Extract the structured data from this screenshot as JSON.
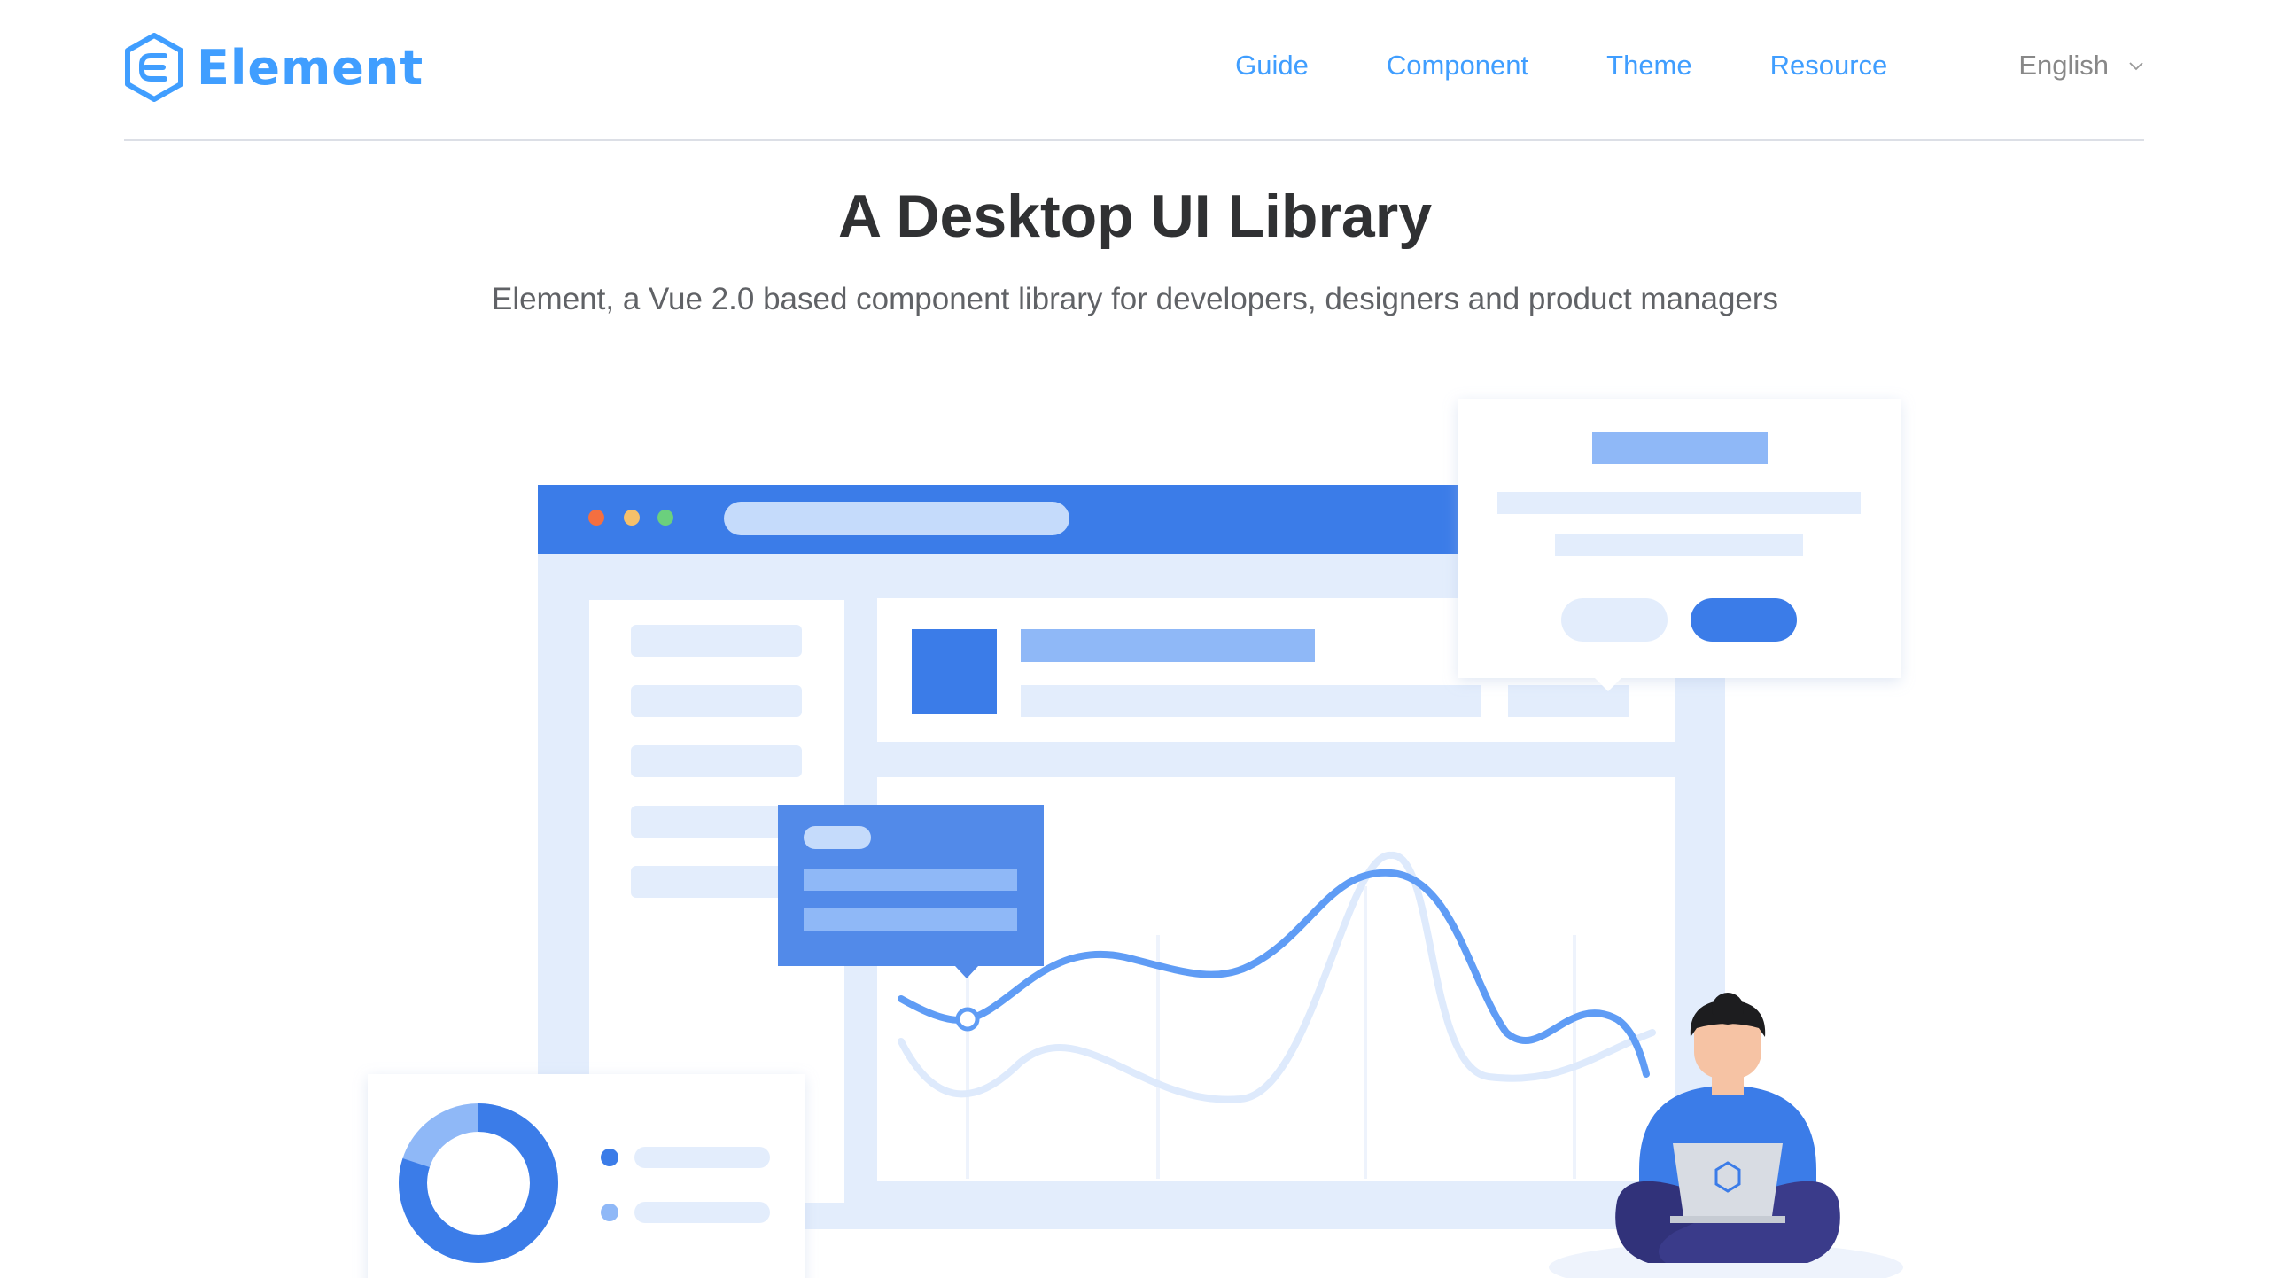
{
  "brand": {
    "name": "Element",
    "color": "#409eff"
  },
  "nav": {
    "items": [
      {
        "label": "Guide"
      },
      {
        "label": "Component"
      },
      {
        "label": "Theme"
      },
      {
        "label": "Resource"
      }
    ],
    "language": {
      "label": "English",
      "icon": "chevron-down-icon"
    }
  },
  "hero": {
    "title": "A Desktop UI Library",
    "subtitle": "Element, a Vue 2.0 based component library for developers, designers and product managers"
  },
  "illustration": {
    "palette": {
      "primary": "#3b7ce8",
      "light": "#e3edfc",
      "mid": "#8fb8f7",
      "pale": "#c5dbfb",
      "window_dots": [
        "#f46f40",
        "#f6c06a",
        "#6bd07d"
      ],
      "person_shirt": "#3b7ce8",
      "person_pants": "#31327a",
      "skin": "#f6c3a4",
      "hair": "#1d1d1f"
    },
    "donut_fraction": 0.8
  }
}
